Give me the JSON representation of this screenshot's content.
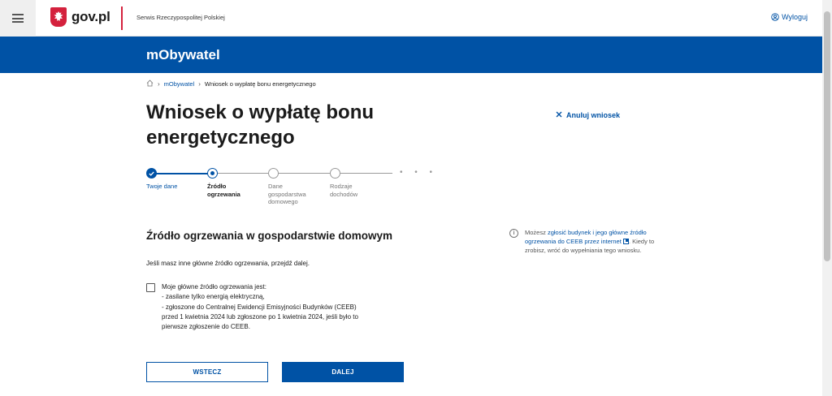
{
  "header": {
    "logo_text": "gov.pl",
    "service_name": "Serwis Rzeczypospolitej Polskiej",
    "logout_label": "Wyloguj",
    "accent": "#d4213d",
    "brand": "#0052a5"
  },
  "band": {
    "app_name": "mObywatel"
  },
  "breadcrumb": {
    "home_icon": "home-icon",
    "items": [
      "mObywatel",
      "Wniosek o wypłatę bonu energetycznego"
    ]
  },
  "page": {
    "title": "Wniosek o wypłatę bonu energetycznego",
    "cancel_label": "Anuluj wniosek"
  },
  "stepper": {
    "steps": [
      {
        "label": "Twoje dane",
        "state": "done"
      },
      {
        "label": "Źródło ogrzewania",
        "state": "current"
      },
      {
        "label": "Dane gospodarstwa domowego",
        "state": "todo"
      },
      {
        "label": "Rodzaje dochodów",
        "state": "todo"
      }
    ],
    "more": "• • •"
  },
  "section": {
    "title": "Źródło ogrzewania w gospodarstwie domowym",
    "hint": "Jeśli masz inne główne źródło ogrzewania, przejdź dalej.",
    "checkbox_lines": [
      "Moje główne źródło ogrzewania jest:",
      "- zasilane tylko energią elektryczną,",
      "- zgłoszone do Centralnej Ewidencji Emisyjności Budynków (CEEB)",
      "przed 1 kwietnia 2024 lub zgłoszone po 1 kwietnia 2024, jeśli było to",
      "pierwsze zgłoszenie do CEEB."
    ],
    "checkbox_checked": false
  },
  "buttons": {
    "back": "WSTECZ",
    "next": "DALEJ"
  },
  "info": {
    "prefix": "Możesz ",
    "link": "zgłosić budynek i jego główne źródło ogrzewania do CEEB przez internet",
    "suffix": ". Kiedy to zrobisz, wróć do wypełniania tego wniosku."
  }
}
